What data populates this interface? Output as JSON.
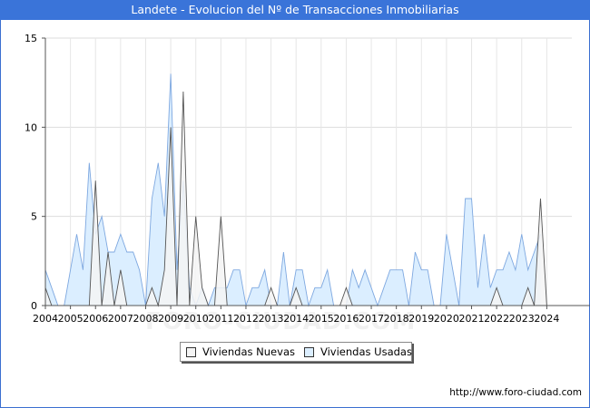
{
  "header": {
    "title": "Landete - Evolucion del Nº de Transacciones Inmobiliarias"
  },
  "watermark": "FORO-CIUDAD.COM",
  "footer": {
    "url": "http://www.foro-ciudad.com"
  },
  "chart_data": {
    "type": "area",
    "title": "Landete - Evolucion del Nº de Transacciones Inmobiliarias",
    "xlabel": "",
    "ylabel": "",
    "ylim": [
      0,
      15
    ],
    "yticks": [
      0,
      5,
      10,
      15
    ],
    "xlim": [
      2004,
      2025
    ],
    "xticks": [
      "2004",
      "2005",
      "2006",
      "2007",
      "2008",
      "2009",
      "2010",
      "2011",
      "2012",
      "2013",
      "2014",
      "2015",
      "2016",
      "2017",
      "2018",
      "2019",
      "2020",
      "2021",
      "2022",
      "2023",
      "2024"
    ],
    "grid": true,
    "legend_position": "bottom-center",
    "x_note": "quarterly periods, 4 per year starting 2004 Q1",
    "series": [
      {
        "name": "Viviendas Nuevas",
        "fill": "#f4f4f4",
        "stroke": "#555555",
        "values": [
          1,
          0,
          0,
          0,
          0,
          0,
          0,
          0,
          7,
          0,
          3,
          0,
          2,
          0,
          0,
          0,
          0,
          1,
          0,
          2,
          10,
          0,
          12,
          0,
          5,
          1,
          0,
          0,
          5,
          0,
          0,
          0,
          0,
          0,
          0,
          0,
          1,
          0,
          0,
          0,
          1,
          0,
          0,
          0,
          0,
          0,
          0,
          0,
          1,
          0,
          0,
          0,
          0,
          0,
          0,
          0,
          0,
          0,
          0,
          0,
          0,
          0,
          0,
          0,
          0,
          0,
          0,
          0,
          0,
          0,
          0,
          0,
          1,
          0,
          0,
          0,
          0,
          1,
          0,
          6,
          0,
          0,
          0,
          0,
          0,
          0,
          0,
          0,
          0,
          0,
          0,
          0,
          0,
          0,
          0,
          0,
          0,
          0,
          0,
          0,
          0,
          0,
          0,
          0
        ]
      },
      {
        "name": "Viviendas Usadas",
        "fill": "#dbeeff",
        "stroke": "#7ea8e0",
        "values": [
          2,
          1,
          0,
          0,
          2,
          4,
          2,
          8,
          4,
          5,
          3,
          3,
          4,
          3,
          3,
          2,
          0,
          6,
          8,
          5,
          13,
          2,
          7,
          1,
          0,
          1,
          0,
          1,
          1,
          1,
          2,
          2,
          0,
          1,
          1,
          2,
          0,
          0,
          3,
          0,
          2,
          2,
          0,
          1,
          1,
          2,
          0,
          0,
          0,
          2,
          1,
          2,
          1,
          0,
          1,
          2,
          2,
          2,
          0,
          3,
          2,
          2,
          0,
          0,
          4,
          2,
          0,
          6,
          6,
          1,
          4,
          1,
          2,
          2,
          3,
          2,
          4,
          2,
          3,
          4
        ]
      }
    ]
  }
}
